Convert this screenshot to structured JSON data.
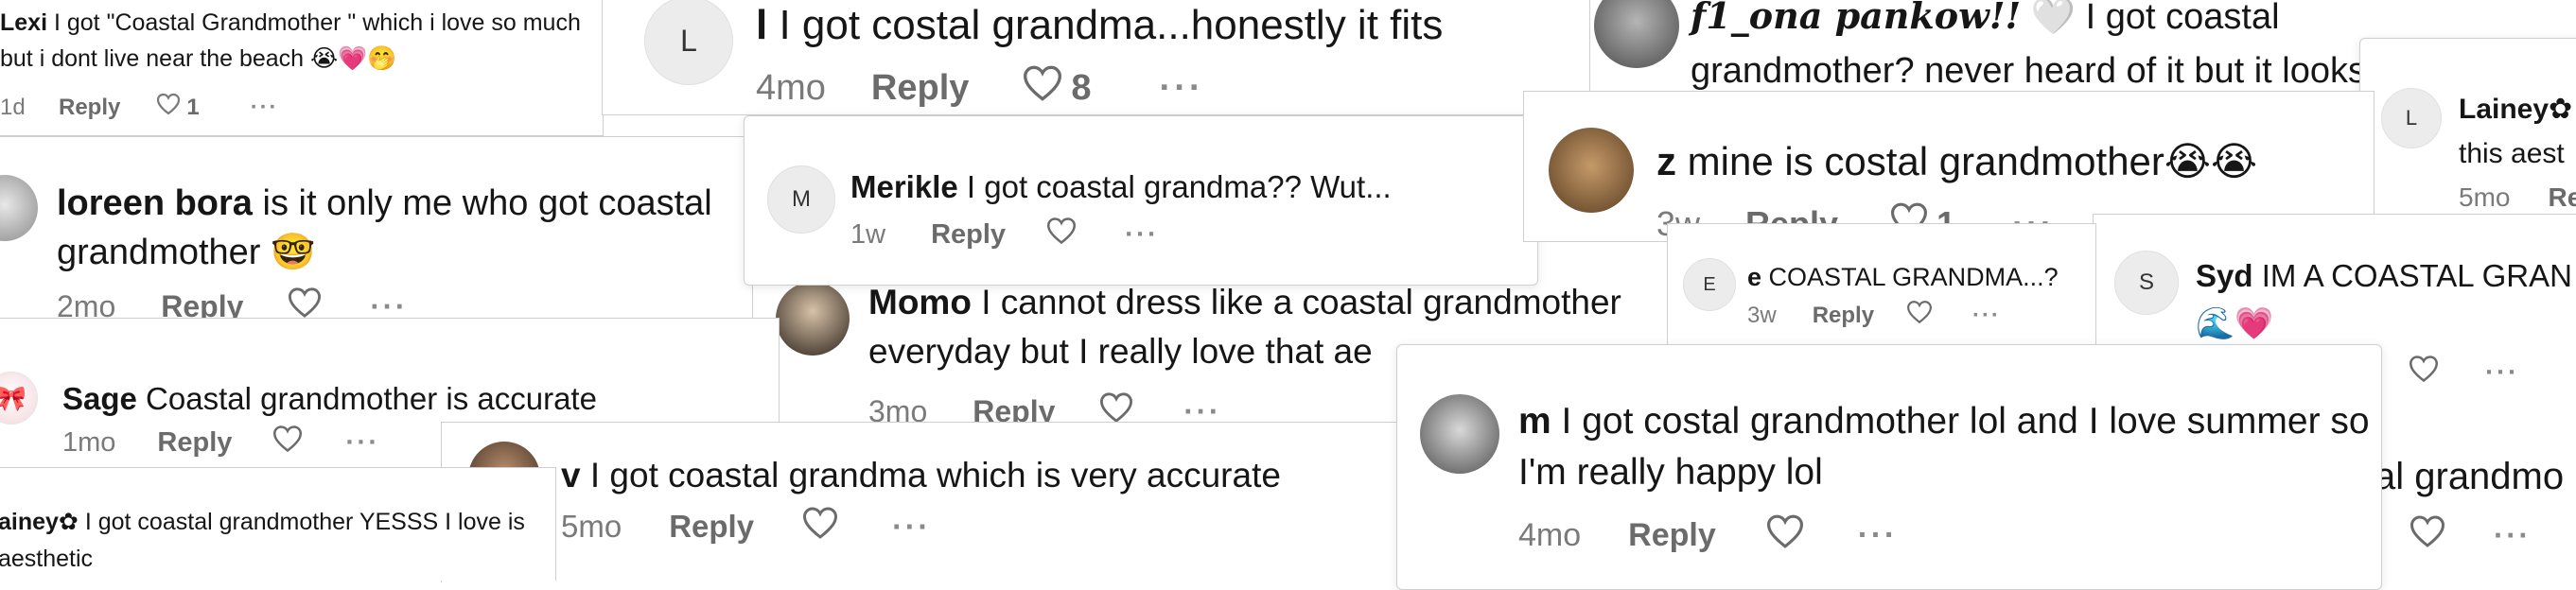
{
  "comments": {
    "lexi": {
      "user": "Lexi",
      "text": "I got \"Coastal Grandmother \" which i love so much but i dont live near the beach",
      "emoji": "😭💗🤭",
      "time": "1d",
      "reply": "Reply",
      "likes": "1",
      "more": "···"
    },
    "top_l": {
      "avatar": "L",
      "user": "l",
      "text": "I got costal grandma...honestly it fits",
      "time": "4mo",
      "reply": "Reply",
      "likes": "8",
      "more": "···"
    },
    "fiona": {
      "user": "𝒇1_𝒐𝒏𝒂 𝒑𝒂𝒏𝒌𝒐𝒘!!",
      "emoji": "🤍",
      "text": "I got coastal grandmother? never heard of it but it looks like me!"
    },
    "lainey_right": {
      "avatar": "L",
      "user": "Lainey✿",
      "text": "this aest",
      "time": "5mo",
      "reply": "Re"
    },
    "loreen": {
      "user": "loreen bora",
      "text": "is it only me who got coastal grandmother",
      "emoji": "🤓",
      "time": "2mo",
      "reply": "Reply",
      "more": "···"
    },
    "merikle": {
      "avatar": "M",
      "user": "Merikle",
      "text": "I got coastal grandma?? Wut...",
      "time": "1w",
      "reply": "Reply",
      "more": "···"
    },
    "z": {
      "user": "z",
      "text": "mine is costal grandmother",
      "emoji": "😭😭",
      "time": "3w",
      "reply": "Reply",
      "likes": "1",
      "more": "···"
    },
    "e": {
      "avatar": "E",
      "user": "e",
      "text": "COASTAL GRANDMA...?",
      "time": "3w",
      "reply": "Reply",
      "more": "···"
    },
    "syd": {
      "avatar": "S",
      "user": "Syd",
      "text": "IM A COASTAL GRAN",
      "emoji": "🌊💗",
      "more": "···"
    },
    "momo": {
      "user": "Momo",
      "text": "I cannot dress like a coastal grandmother everyday but I really love that ae",
      "time": "3mo",
      "reply": "Reply",
      "more": "···"
    },
    "sage": {
      "user": "Sage",
      "text": "Coastal grandmother is accurate",
      "time": "1mo",
      "reply": "Reply",
      "more": "···"
    },
    "v": {
      "user": "v",
      "text": "I got coastal grandma which is very accurate",
      "time": "5mo",
      "reply": "Reply",
      "more": "···"
    },
    "m": {
      "user": "m",
      "text": "I got costal grandmother lol and I love summer so I'm really happy lol",
      "time": "4mo",
      "reply": "Reply",
      "more": "···"
    },
    "right_bottom": {
      "text": "al grandmo",
      "more": "···"
    },
    "lainey_bottom": {
      "user": "ainey✿",
      "text": "I got coastal grandmother YESSS I love is aesthetic"
    }
  },
  "colors": {
    "text": "#161616",
    "muted": "#7a7a7a",
    "border": "#cfcfcf",
    "avatar_bg": "#ececec"
  }
}
